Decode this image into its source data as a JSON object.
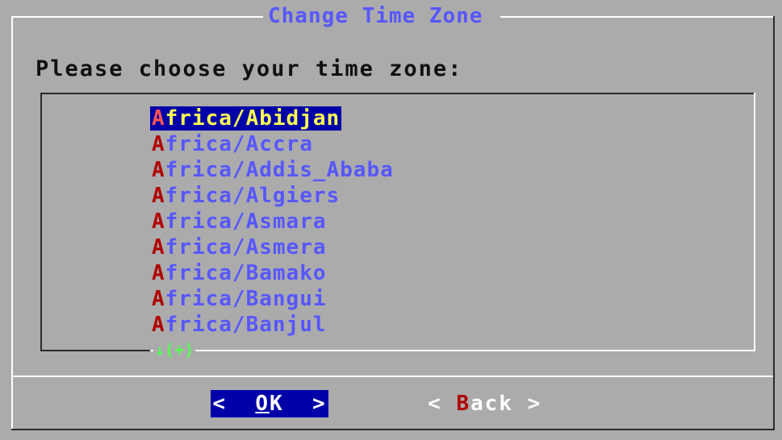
{
  "dialog": {
    "title": "Change Time Zone",
    "prompt": "Please choose your time zone:"
  },
  "list": {
    "items": [
      {
        "hot": "A",
        "rest": "frica/Abidjan",
        "selected": true
      },
      {
        "hot": "A",
        "rest": "frica/Accra"
      },
      {
        "hot": "A",
        "rest": "frica/Addis_Ababa"
      },
      {
        "hot": "A",
        "rest": "frica/Algiers"
      },
      {
        "hot": "A",
        "rest": "frica/Asmara"
      },
      {
        "hot": "A",
        "rest": "frica/Asmera"
      },
      {
        "hot": "A",
        "rest": "frica/Bamako"
      },
      {
        "hot": "A",
        "rest": "frica/Bangui"
      },
      {
        "hot": "A",
        "rest": "frica/Banjul"
      }
    ],
    "scroll_indicator": "↓(+)"
  },
  "buttons": {
    "ok": {
      "left": "<  ",
      "hot": "O",
      "rest": "K",
      "right": "  >"
    },
    "back": {
      "left": "< ",
      "hot": "B",
      "rest": "ack",
      "right": " >"
    }
  },
  "colors": {
    "background": "#ababab",
    "title": "#5757ff",
    "item_text": "#5757ff",
    "hotkey": "#b00000",
    "selection_bg": "#0000a8",
    "selection_text": "#ffff55",
    "scroll_indicator": "#55ff55"
  }
}
